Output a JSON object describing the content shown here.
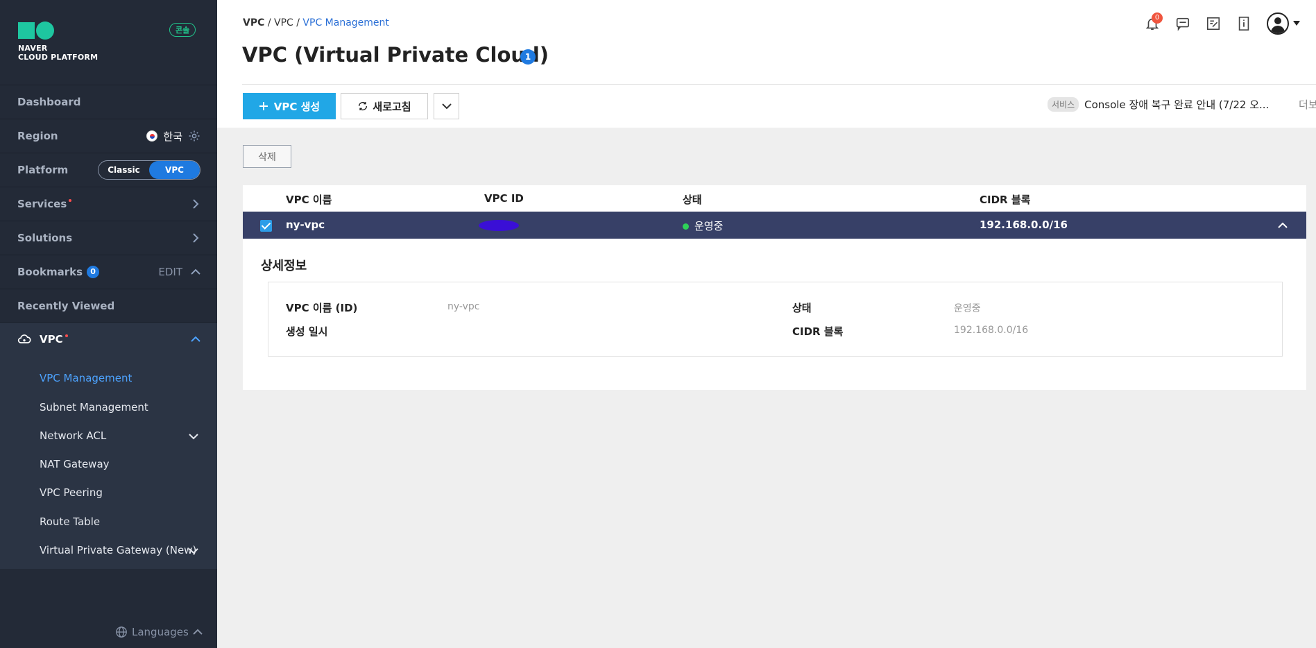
{
  "sidebar": {
    "logo_line1": "NAVER",
    "logo_line2": "CLOUD PLATFORM",
    "console_badge": "콘솔",
    "dashboard": "Dashboard",
    "region_label": "Region",
    "region_value": "한국",
    "platform_label": "Platform",
    "platform_options": [
      "Classic",
      "VPC"
    ],
    "platform_selected": "VPC",
    "services": "Services",
    "solutions": "Solutions",
    "bookmarks": "Bookmarks",
    "bookmarks_count": "0",
    "bookmarks_edit": "EDIT",
    "recently_viewed": "Recently Viewed",
    "vpc": "VPC",
    "sub_items": [
      "VPC Management",
      "Subnet Management",
      "Network ACL",
      "NAT Gateway",
      "VPC Peering",
      "Route Table",
      "Virtual Private Gateway (New)"
    ],
    "languages": "Languages"
  },
  "header": {
    "breadcrumb": [
      "VPC",
      "VPC",
      "VPC Management"
    ],
    "title": "VPC (Virtual Private Cloud)",
    "title_count": "1",
    "notification_count": "0"
  },
  "toolbar": {
    "create_label": "VPC 생성",
    "refresh_label": "새로고침",
    "delete_label": "삭제"
  },
  "notice": {
    "tag": "서비스",
    "text": "Console 장애 복구 완료 안내 (7/22 오...",
    "more": "더보기"
  },
  "table": {
    "columns": [
      "VPC 이름",
      "VPC ID",
      "상태",
      "CIDR 블록"
    ],
    "rows": [
      {
        "name": "ny-vpc",
        "id": "",
        "status": "운영중",
        "cidr": "192.168.0.0/16",
        "checked": true
      }
    ]
  },
  "detail": {
    "title": "상세정보",
    "name_label": "VPC 이름 (ID)",
    "name_value": "ny-vpc",
    "created_label": "생성 일시",
    "created_value": "",
    "status_label": "상태",
    "status_value": "운영중",
    "cidr_label": "CIDR 블록",
    "cidr_value": "192.168.0.0/16"
  },
  "colors": {
    "sidebar_bg": "#232a37",
    "accent": "#1f7ae0",
    "primary_button": "#21a7e6",
    "selected_row": "#374067",
    "status_ok": "#2ed158"
  }
}
